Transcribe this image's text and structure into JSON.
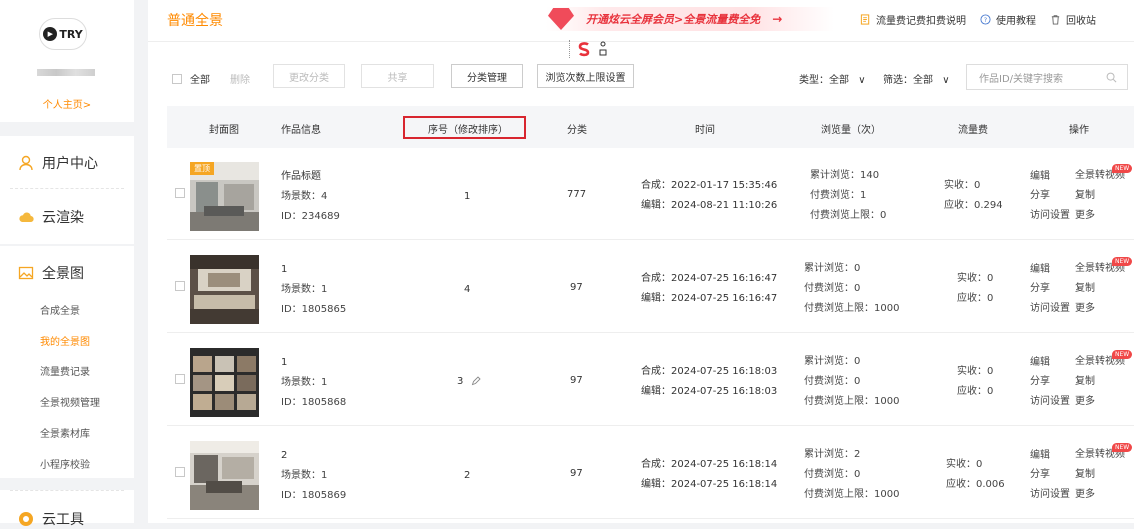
{
  "sidebar": {
    "logo_text": "TRY",
    "home_link": "个人主页>",
    "menu": [
      {
        "label": "用户中心",
        "icon": "user-icon"
      },
      {
        "label": "云渲染",
        "icon": "cloud-icon"
      },
      {
        "label": "全景图",
        "icon": "image-icon"
      },
      {
        "label": "云工具",
        "icon": "tool-icon"
      }
    ],
    "sub_items": [
      "合成全景",
      "我的全景图",
      "流量费记录",
      "全景视频管理",
      "全景素材库",
      "小程序校验"
    ],
    "active_sub": "我的全景图"
  },
  "topbar": {
    "title": "普通全景",
    "banner_text": "开通炫云全屏会员>全景流量费全免",
    "banner_arrow": "→",
    "links": [
      "流量费记费扣费说明",
      "使用教程",
      "回收站"
    ]
  },
  "toolbar": {
    "all_label": "全部",
    "delete_label": "删除",
    "change_category": "更改分类",
    "share": "共享",
    "category_manage": "分类管理",
    "view_limit_setting": "浏览次数上限设置",
    "type_filter": "类型：全部",
    "screen_filter": "筛选：全部",
    "search_placeholder": "作品ID/关键字搜索"
  },
  "table": {
    "headers": [
      "封面图",
      "作品信息",
      "序号（修改排序）",
      "分类",
      "时间",
      "浏览量（次）",
      "流量费",
      "操作"
    ],
    "rows": [
      {
        "tag": "置顶",
        "name": "作品标题",
        "scenes": "场景数：4",
        "id": "ID：234689",
        "order": "1",
        "category": "777",
        "created": "合成：2022-01-17 15:35:46",
        "edited": "编辑：2024-08-21 11:10:26",
        "views_total": "累计浏览：140",
        "views_paid": "付费浏览：1",
        "views_limit": "付费浏览上限：0",
        "fee_actual": "实收：0",
        "fee_due": "应收：0.294",
        "show_pencil": false
      },
      {
        "tag": "",
        "name": "1",
        "scenes": "场景数：1",
        "id": "ID：1805865",
        "order": "4",
        "category": "97",
        "created": "合成：2024-07-25 16:16:47",
        "edited": "编辑：2024-07-25 16:16:47",
        "views_total": "累计浏览：0",
        "views_paid": "付费浏览：0",
        "views_limit": "付费浏览上限：1000",
        "fee_actual": "实收：0",
        "fee_due": "应收：0",
        "show_pencil": false
      },
      {
        "tag": "",
        "name": "1",
        "scenes": "场景数：1",
        "id": "ID：1805868",
        "order": "3",
        "category": "97",
        "created": "合成：2024-07-25 16:18:03",
        "edited": "编辑：2024-07-25 16:18:03",
        "views_total": "累计浏览：0",
        "views_paid": "付费浏览：0",
        "views_limit": "付费浏览上限：1000",
        "fee_actual": "实收：0",
        "fee_due": "应收：0",
        "show_pencil": true
      },
      {
        "tag": "",
        "name": "2",
        "scenes": "场景数：1",
        "id": "ID：1805869",
        "order": "2",
        "category": "97",
        "created": "合成：2024-07-25 16:18:14",
        "edited": "编辑：2024-07-25 16:18:14",
        "views_total": "累计浏览：2",
        "views_paid": "付费浏览：0",
        "views_limit": "付费浏览上限：1000",
        "fee_actual": "实收：0",
        "fee_due": "应收：0.006",
        "show_pencil": false
      }
    ],
    "actions": {
      "edit": "编辑",
      "to_video": "全景转视频",
      "share": "分享",
      "copy": "复制",
      "access": "访问设置",
      "more": "更多",
      "new_badge": "NEW"
    }
  },
  "colors": {
    "accent": "#ff8a00",
    "highlight_border": "#d8262f",
    "banner_text": "#e8323c"
  }
}
